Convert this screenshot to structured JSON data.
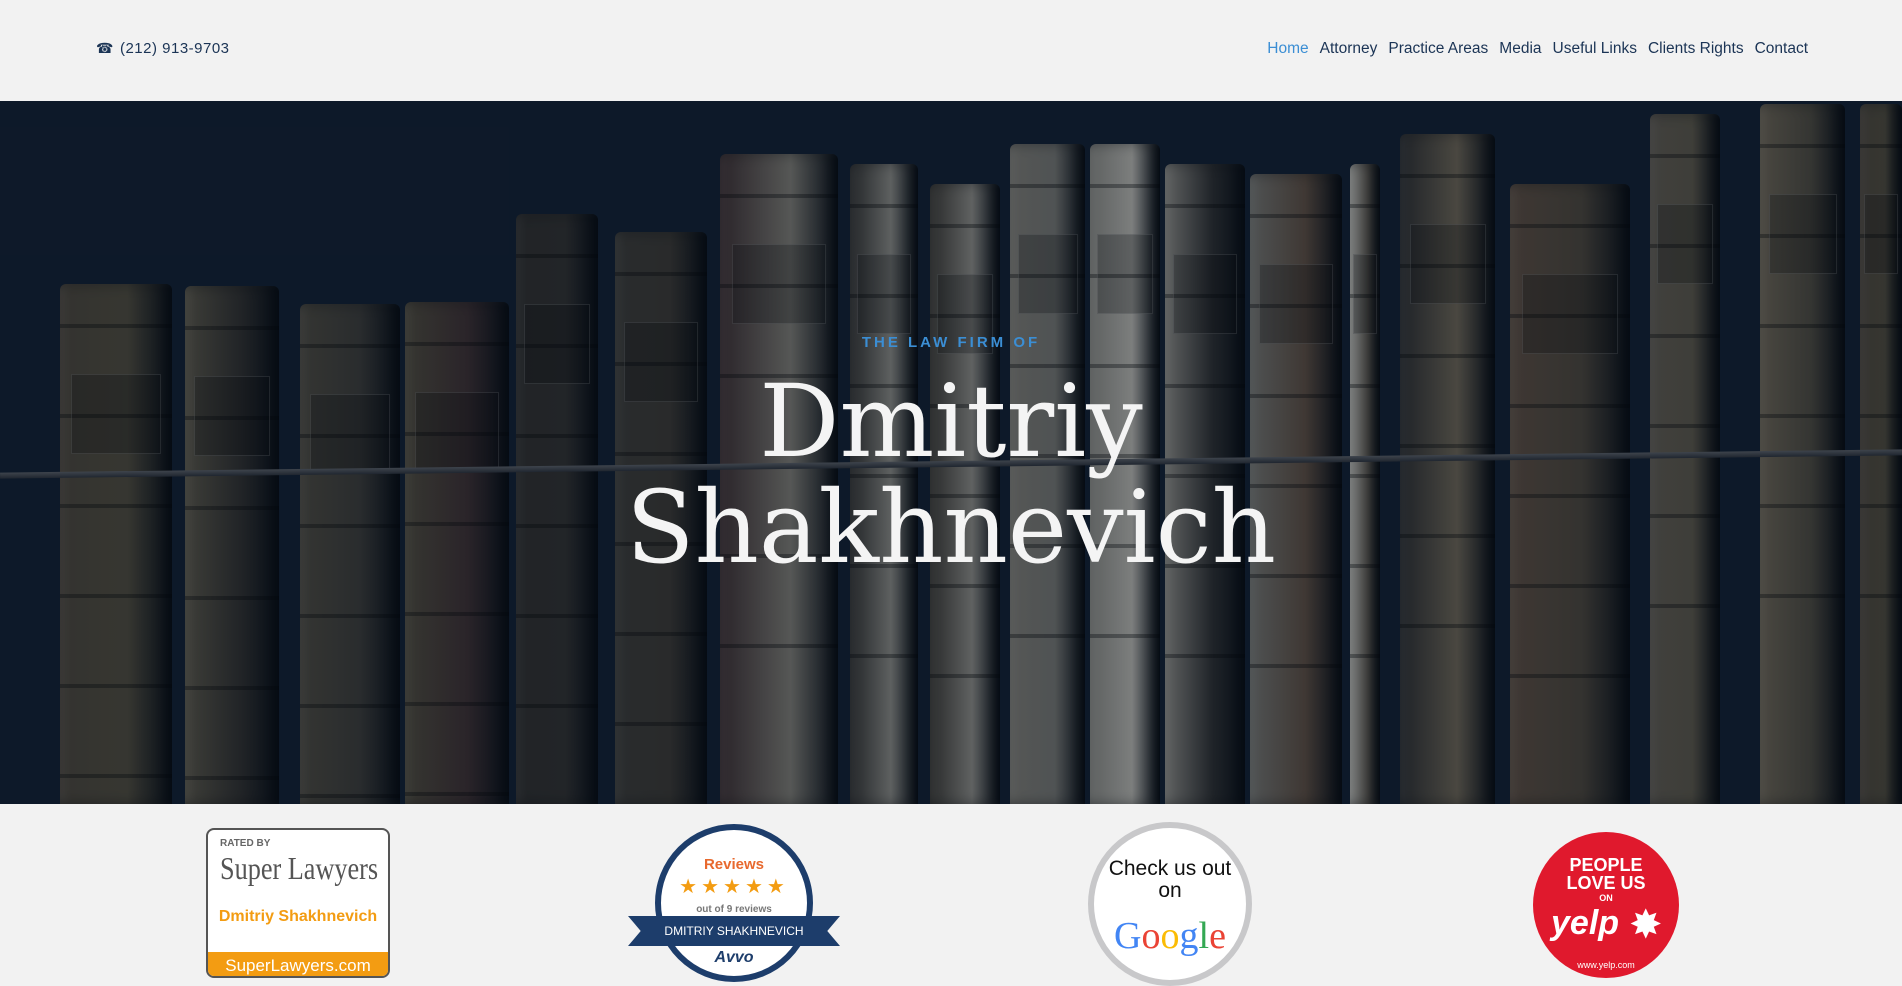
{
  "header": {
    "phone": "(212) 913-9703",
    "phone_icon": "phone-icon",
    "nav": [
      "Home",
      "Attorney",
      "Practice Areas",
      "Media",
      "Useful Links",
      "Clients Rights",
      "Contact"
    ],
    "active_nav": "Home"
  },
  "hero": {
    "kicker": "THE LAW FIRM OF",
    "title_line1": "Dmitriy",
    "title_line2": "Shakhnevich"
  },
  "badges": {
    "superlawyers": {
      "rated": "RATED BY",
      "brand": "Super Lawyers",
      "name": "Dmitriy Shakhnevich",
      "url": "SuperLawyers.com"
    },
    "avvo": {
      "reviews": "Reviews",
      "stars": "★★★★★",
      "out_of": "out of 9 reviews",
      "name": "DMITRIY SHAKHNEVICH",
      "logo": "Avvo"
    },
    "google": {
      "text_line1": "Check us out",
      "text_line2": "on",
      "logo": "Google"
    },
    "yelp": {
      "text": "PEOPLE LOVE US",
      "on": "ON",
      "logo": "yelp",
      "url": "www.yelp.com"
    }
  },
  "colors": {
    "accent": "#3b8ed4",
    "navy": "#1b3455",
    "hero_bg": "#0f1b2b"
  }
}
